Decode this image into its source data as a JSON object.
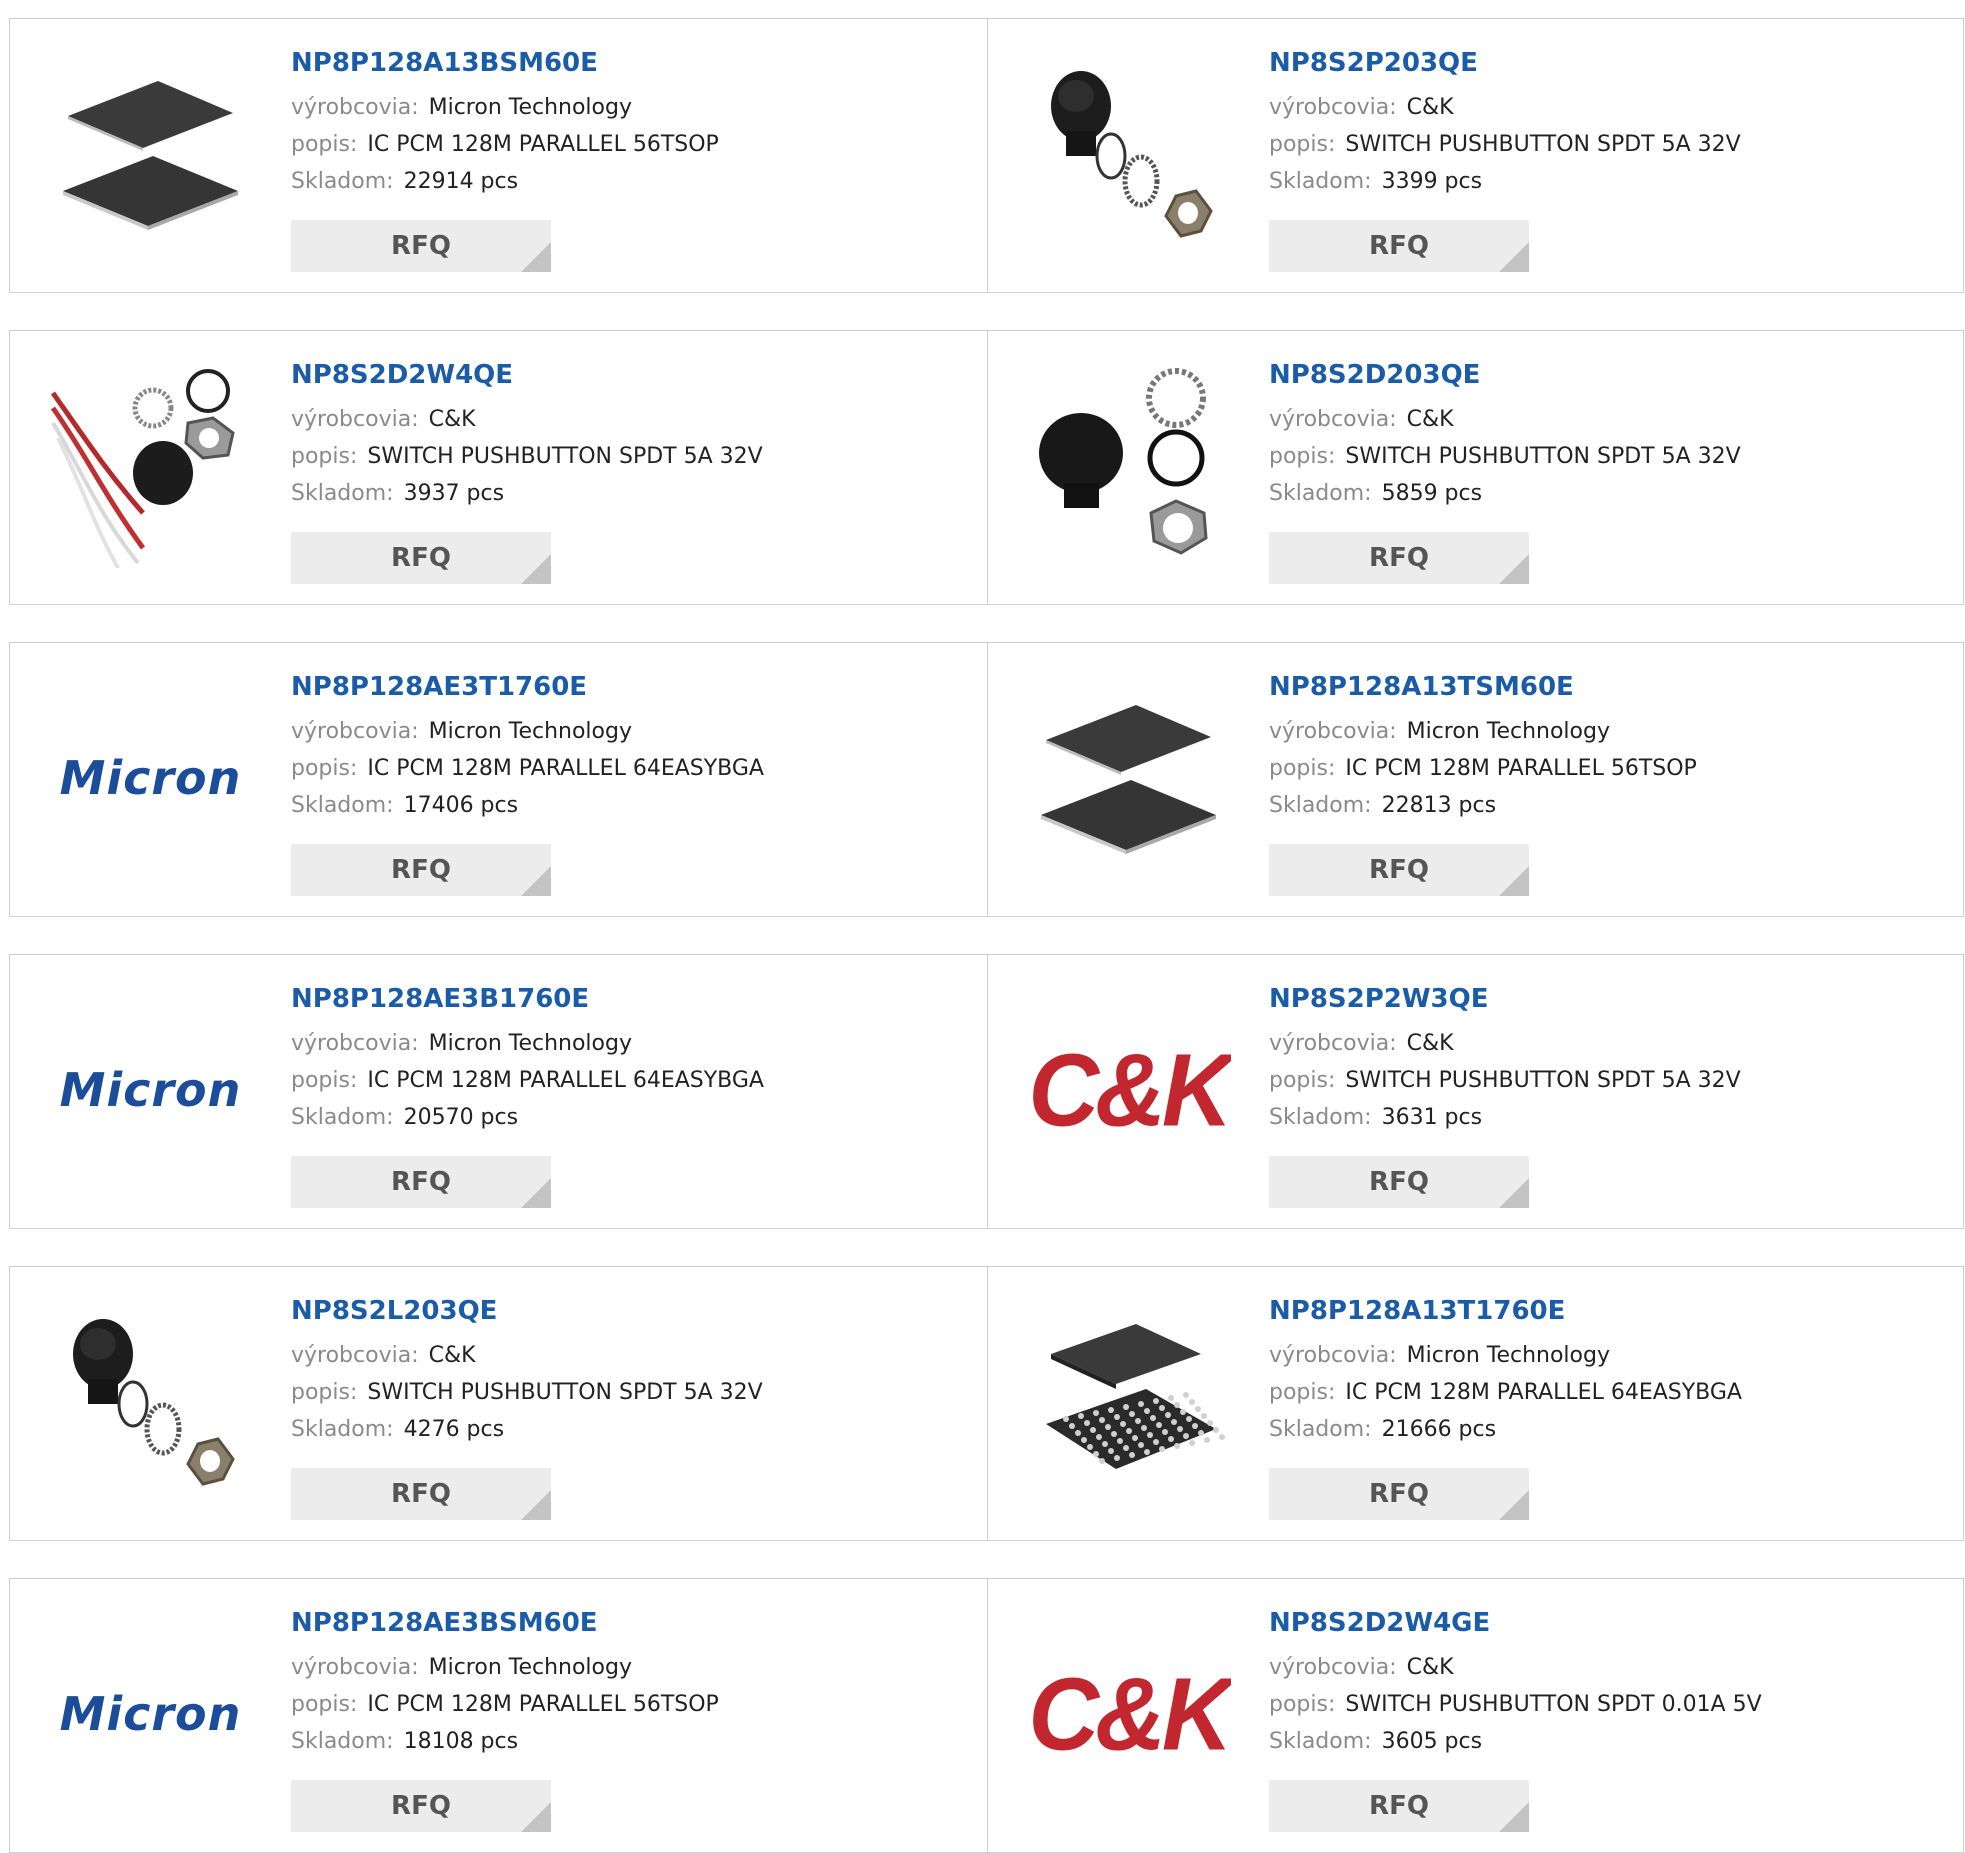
{
  "labels": {
    "manufacturer": "výrobcovia:",
    "description": "popis:",
    "stock": "Skladom:",
    "rfq": "RFQ"
  },
  "colors": {
    "part_link": "#1a5ca8",
    "label": "#8a8a8a",
    "rfq_bg": "#ececec",
    "border": "#cfcfcf",
    "micron_blue": "#1b4d9a",
    "ck_red": "#c2272f"
  },
  "logos": {
    "micron": "Micron",
    "ck": "C&K"
  },
  "products": [
    {
      "part": "NP8P128A13BSM60E",
      "manufacturer": "Micron Technology",
      "description": "IC PCM 128M PARALLEL 56TSOP",
      "stock": "22914 pcs",
      "image": "tsop-chip"
    },
    {
      "part": "NP8S2P203QE",
      "manufacturer": "C&K",
      "description": "SWITCH PUSHBUTTON SPDT 5A 32V",
      "stock": "3399 pcs",
      "image": "pushbutton-kit"
    },
    {
      "part": "NP8S2D2W4QE",
      "manufacturer": "C&K",
      "description": "SWITCH PUSHBUTTON SPDT 5A 32V",
      "stock": "3937 pcs",
      "image": "pushbutton-wired"
    },
    {
      "part": "NP8S2D203QE",
      "manufacturer": "C&K",
      "description": "SWITCH PUSHBUTTON SPDT 5A 32V",
      "stock": "5859 pcs",
      "image": "pushbutton-kit-large"
    },
    {
      "part": "NP8P128AE3T1760E",
      "manufacturer": "Micron Technology",
      "description": "IC PCM 128M PARALLEL 64EASYBGA",
      "stock": "17406 pcs",
      "image": "micron-logo"
    },
    {
      "part": "NP8P128A13TSM60E",
      "manufacturer": "Micron Technology",
      "description": "IC PCM 128M PARALLEL 56TSOP",
      "stock": "22813 pcs",
      "image": "tsop-chip"
    },
    {
      "part": "NP8P128AE3B1760E",
      "manufacturer": "Micron Technology",
      "description": "IC PCM 128M PARALLEL 64EASYBGA",
      "stock": "20570 pcs",
      "image": "micron-logo"
    },
    {
      "part": "NP8S2P2W3QE",
      "manufacturer": "C&K",
      "description": "SWITCH PUSHBUTTON SPDT 5A 32V",
      "stock": "3631 pcs",
      "image": "ck-logo"
    },
    {
      "part": "NP8S2L203QE",
      "manufacturer": "C&K",
      "description": "SWITCH PUSHBUTTON SPDT 5A 32V",
      "stock": "4276 pcs",
      "image": "pushbutton-kit"
    },
    {
      "part": "NP8P128A13T1760E",
      "manufacturer": "Micron Technology",
      "description": "IC PCM 128M PARALLEL 64EASYBGA",
      "stock": "21666 pcs",
      "image": "bga-chip"
    },
    {
      "part": "NP8P128AE3BSM60E",
      "manufacturer": "Micron Technology",
      "description": "IC PCM 128M PARALLEL 56TSOP",
      "stock": "18108 pcs",
      "image": "micron-logo"
    },
    {
      "part": "NP8S2D2W4GE",
      "manufacturer": "C&K",
      "description": "SWITCH PUSHBUTTON SPDT 0.01A 5V",
      "stock": "3605 pcs",
      "image": "ck-logo"
    }
  ]
}
